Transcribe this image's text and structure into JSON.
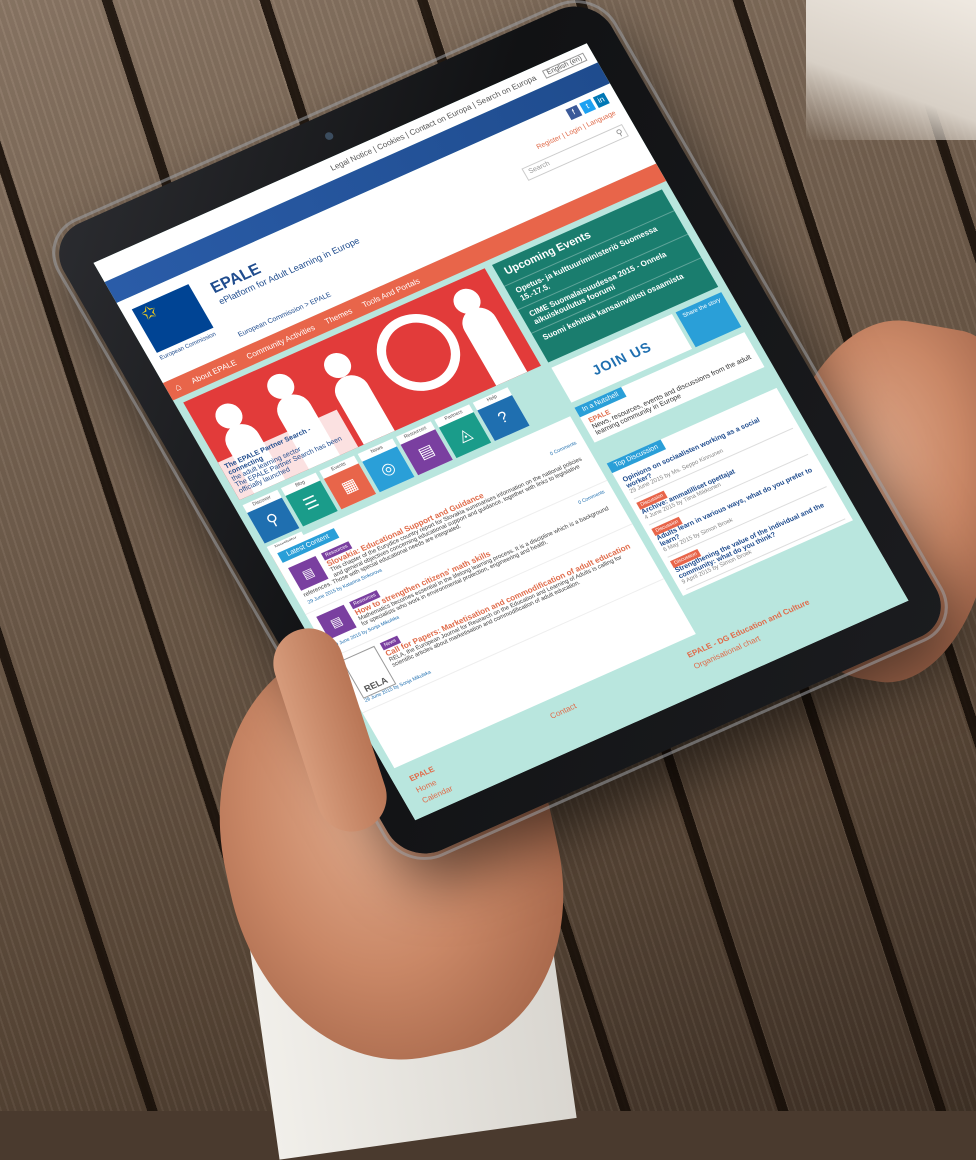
{
  "util_bar": {
    "links": "Legal Notice | Cookies | Contact on Europa | Search on Europa",
    "language": "English (en)"
  },
  "header": {
    "ec_caption": "European Commission",
    "brand_name": "EPALE",
    "brand_tagline": "ePlatform for Adult Learning in Europe",
    "login_links": "Register | Login | Language",
    "search_placeholder": "Search",
    "breadcrumb": "European Commission > EPALE"
  },
  "nav": {
    "items": [
      "About EPALE",
      "Community Activities",
      "Themes",
      "Tools And Portals"
    ]
  },
  "hero": {
    "caption_title": "The EPALE Partner Search - connecting",
    "caption_line2": "the adult learning sector",
    "caption_line3": "The EPALE Partner Search has been",
    "caption_line4": "officially launched"
  },
  "events": {
    "title": "Upcoming Events",
    "items": [
      "Opetus- ja kulttuuriministeriö Suomessa 15.-17.5.",
      "CIME Suomalaisuudessa 2015 - Onnela aikuiskoulutus foorumi",
      "Suomi kehittää kansainvälisti osaamista"
    ]
  },
  "tiles": [
    {
      "label": "Discover",
      "icon": "⚲",
      "color": "#1f6fb0"
    },
    {
      "label": "Blog",
      "icon": "☰",
      "color": "#1a9c8a"
    },
    {
      "label": "Events",
      "icon": "▦",
      "color": "#e8654a"
    },
    {
      "label": "News",
      "icon": "◎",
      "color": "#2a9fd8"
    },
    {
      "label": "Resources",
      "icon": "▤",
      "color": "#7a3fa0"
    },
    {
      "label": "Partners",
      "icon": "◬",
      "color": "#1a9c8a"
    },
    {
      "label": "Help",
      "icon": "?",
      "color": "#1f6fb0"
    },
    {
      "label": "Newsletter",
      "icon": "✉",
      "color": "#e8654a"
    }
  ],
  "promo": {
    "join_label": "JOIN US",
    "share_label": "Share the story"
  },
  "nutshell": {
    "tab": "In a Nutshell",
    "heading": "EPALE",
    "text": "News, resources, events and discussions from the adult learning community in Europe"
  },
  "discussions": {
    "tab": "Top Discussion",
    "items": [
      {
        "title": "Opinions on sociaalisten working as a social worker?",
        "meta": "29 June 2015  by Ms. Seppo Kinnunen",
        "tag": ""
      },
      {
        "title": "Archive: ammatilliset opettajat",
        "meta": "4 June 2015  by Tiina Mikkonen",
        "tag": "Discussion"
      },
      {
        "title": "Adults learn in various ways, what do you prefer to learn?",
        "meta": "6 May 2015  by Simon Broek",
        "tag": "Discussion"
      },
      {
        "title": "Strengthening the value of the individual and the community: what do you think?",
        "meta": "9 April 2015  by Simon Broek",
        "tag": "Discussion"
      }
    ]
  },
  "latest": {
    "tab": "Latest Content",
    "articles": [
      {
        "tag": "Resources",
        "title": "Slovakia: Educational Support and Guidance",
        "text": "This chapter of the Eurydice country report for Slovakia summarises information on the national policies and general objectives concerning educational support and guidance, together with links to legislative references. Those with special educational needs are integrated.",
        "meta": "29 June 2015  by Katarina Sinkorova",
        "comments": "0 Comments"
      },
      {
        "tag": "Resources",
        "title": "How to strengthen citizens' math skills",
        "text": "Mathematics becomes essential in the lifelong learning process. It is a discipline which is a background for specialists who work in environmental protection, engineering and health.",
        "meta": "29 June 2015  by Sonja Mikulska",
        "comments": "0 Comments"
      },
      {
        "tag": "News",
        "title": "Call for Papers: Marketisation and commodification of adult education",
        "text": "RELA, the European Journal for Research on the Education and Learning of Adults is calling for scientific articles about marketisation and commodification of adult education.",
        "meta": "29 June 2015  by Sonja Mikulska",
        "comments": ""
      }
    ],
    "rela_logo": "RELA"
  },
  "footer": {
    "col1_heading": "EPALE",
    "col1_links": [
      "Home",
      "Calendar"
    ],
    "col2_links": [
      "Contact"
    ],
    "col3_heading": "EPALE - DG Education and Culture",
    "col3_links": [
      "Organisational chart"
    ]
  }
}
